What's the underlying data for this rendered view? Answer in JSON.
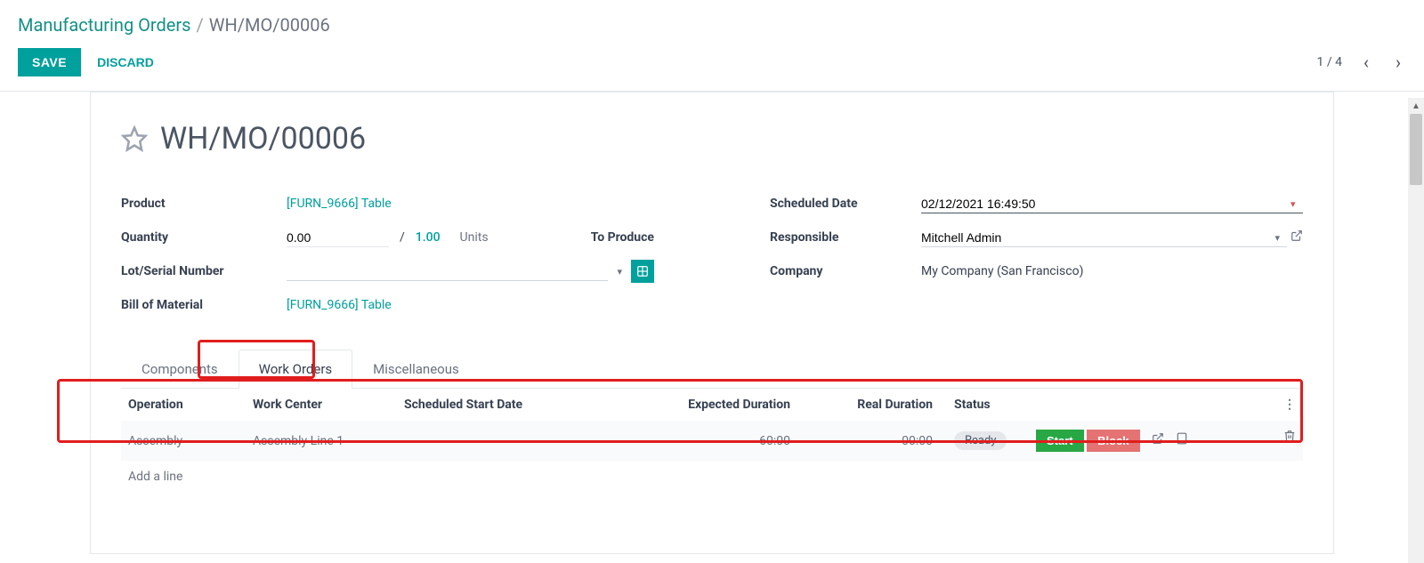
{
  "breadcrumb": {
    "root": "Manufacturing Orders",
    "sep": "/",
    "current": "WH/MO/00006"
  },
  "actions": {
    "save": "SAVE",
    "discard": "DISCARD"
  },
  "pager": {
    "counter": "1 / 4"
  },
  "title": "WH/MO/00006",
  "left": {
    "product_label": "Product",
    "product_value": "[FURN_9666] Table",
    "quantity_label": "Quantity",
    "quantity_value": "0.00",
    "quantity_sep": "/",
    "quantity_target": "1.00",
    "quantity_unit": "Units",
    "to_produce_label": "To Produce",
    "lot_label": "Lot/Serial Number",
    "bom_label": "Bill of Material",
    "bom_value": "[FURN_9666] Table"
  },
  "right": {
    "scheduled_label": "Scheduled Date",
    "scheduled_value": "02/12/2021 16:49:50",
    "responsible_label": "Responsible",
    "responsible_value": "Mitchell Admin",
    "company_label": "Company",
    "company_value": "My Company (San Francisco)"
  },
  "tabs": {
    "components": "Components",
    "work_orders": "Work Orders",
    "misc": "Miscellaneous"
  },
  "table": {
    "headers": {
      "operation": "Operation",
      "work_center": "Work Center",
      "scheduled_start": "Scheduled Start Date",
      "expected": "Expected Duration",
      "real": "Real Duration",
      "status": "Status"
    },
    "row": {
      "operation": "Assembly",
      "work_center": "Assembly Line 1",
      "scheduled_start": "",
      "expected": "60:00",
      "real": "00:00",
      "status": "Ready",
      "start": "Start",
      "block": "Block"
    },
    "add_line": "Add a line"
  }
}
